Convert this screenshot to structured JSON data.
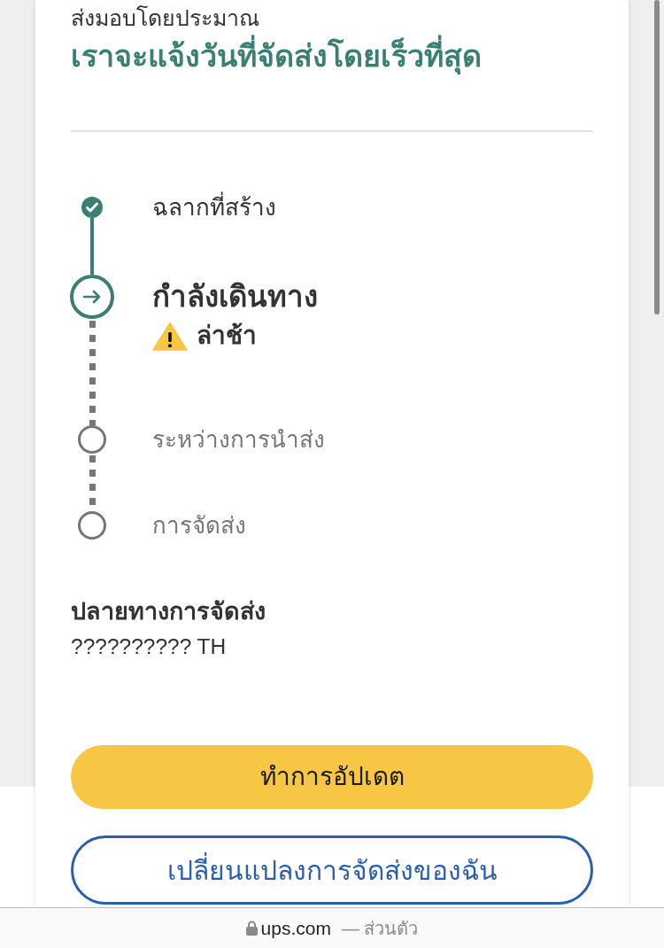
{
  "estimate": {
    "label": "ส่งมอบโดยประมาณ",
    "value": "เราจะแจ้งวันที่จัดส่งโดยเร็วที่สุด"
  },
  "timeline": [
    {
      "kind": "done",
      "label": "ฉลากที่สร้าง"
    },
    {
      "kind": "current",
      "label": "กำลังเดินทาง",
      "alert": "ล่าช้า"
    },
    {
      "kind": "pending",
      "label": "ระหว่างการนำส่ง"
    },
    {
      "kind": "pending",
      "label": "การจัดส่ง"
    }
  ],
  "destination": {
    "label": "ปลายทางการจัดส่ง",
    "value": "?????????? TH"
  },
  "buttons": [
    {
      "kind": "primary",
      "label": "ทำการอัปเดต"
    },
    {
      "kind": "outline",
      "label": "เปลี่ยนแปลงการจัดส่งของฉัน"
    }
  ],
  "browser_bar": {
    "domain": "ups.com",
    "mode": "— ส่วนตัว"
  }
}
